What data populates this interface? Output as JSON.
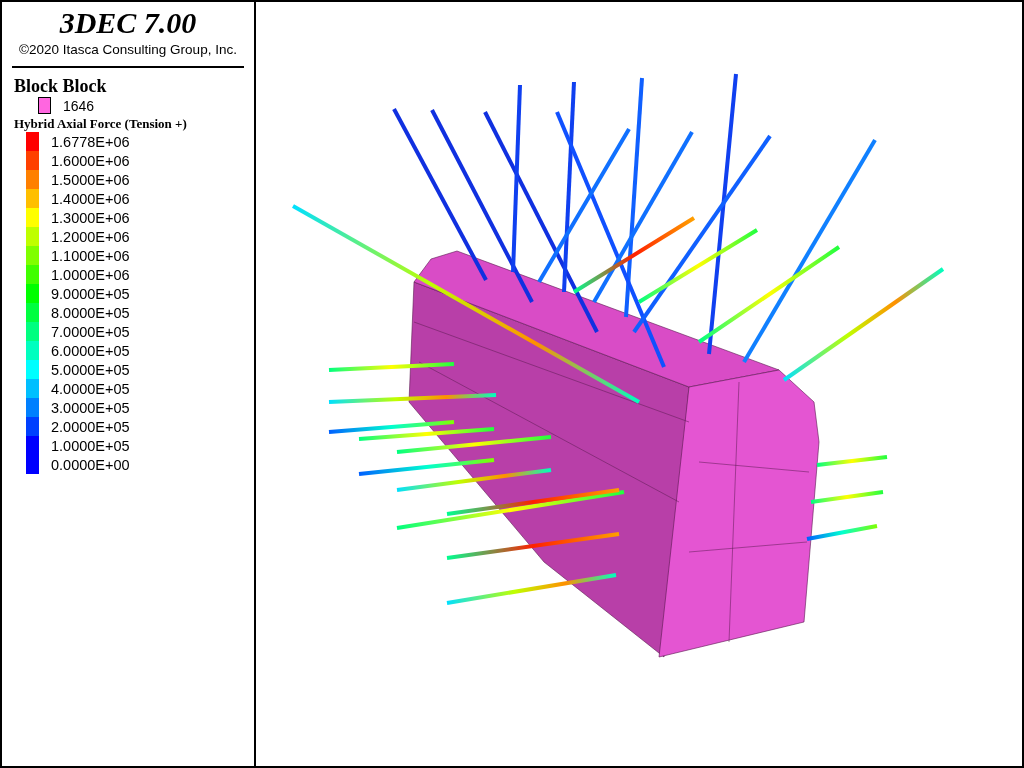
{
  "legend": {
    "title": "3DEC 7.00",
    "copyright": "©2020 Itasca Consulting Group, Inc.",
    "block_heading": "Block Block",
    "block_entry": "1646",
    "contour_heading": "Hybrid Axial Force (Tension +)",
    "contour_items": [
      {
        "label": "1.6778E+06",
        "color": "#ff0000"
      },
      {
        "label": "1.6000E+06",
        "color": "#ff4000"
      },
      {
        "label": "1.5000E+06",
        "color": "#ff8000"
      },
      {
        "label": "1.4000E+06",
        "color": "#ffbf00"
      },
      {
        "label": "1.3000E+06",
        "color": "#ffff00"
      },
      {
        "label": "1.2000E+06",
        "color": "#bfff00"
      },
      {
        "label": "1.1000E+06",
        "color": "#80ff00"
      },
      {
        "label": "1.0000E+06",
        "color": "#40ff00"
      },
      {
        "label": "9.0000E+05",
        "color": "#00ff00"
      },
      {
        "label": "8.0000E+05",
        "color": "#00ff40"
      },
      {
        "label": "7.0000E+05",
        "color": "#00ff80"
      },
      {
        "label": "6.0000E+05",
        "color": "#00ffbf"
      },
      {
        "label": "5.0000E+05",
        "color": "#00ffff"
      },
      {
        "label": "4.0000E+05",
        "color": "#00bfff"
      },
      {
        "label": "3.0000E+05",
        "color": "#0080ff"
      },
      {
        "label": "2.0000E+05",
        "color": "#0040ff"
      },
      {
        "label": "1.0000E+05",
        "color": "#0000ff"
      },
      {
        "label": "0.0000E+00",
        "color": "#0000ff"
      }
    ]
  }
}
